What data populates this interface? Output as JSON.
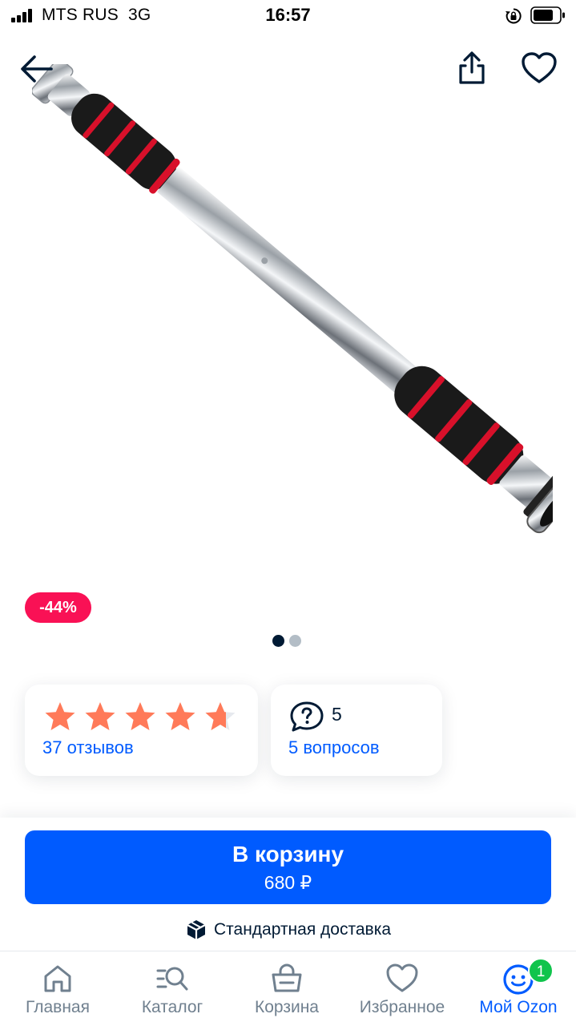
{
  "status_bar": {
    "carrier": "MTS RUS",
    "network": "3G",
    "time": "16:57"
  },
  "product": {
    "discount": "-44%",
    "image_slides": 2,
    "current_slide": 1
  },
  "rating": {
    "stars": 4.5,
    "reviews_label": "37 отзывов"
  },
  "questions": {
    "count": "5",
    "label": "5 вопросов"
  },
  "cart": {
    "button_label": "В корзину",
    "price": "680 ₽"
  },
  "delivery": {
    "label": "Стандартная доставка",
    "icon": "box-icon"
  },
  "colors": {
    "accent": "#005bff",
    "discount": "#f91155",
    "star": "#ff7a59",
    "badge": "#10c44c"
  },
  "tab_bar": {
    "items": [
      {
        "label": "Главная",
        "icon": "home-icon"
      },
      {
        "label": "Каталог",
        "icon": "catalog-search-icon"
      },
      {
        "label": "Корзина",
        "icon": "cart-basket-icon"
      },
      {
        "label": "Избранное",
        "icon": "heart-icon"
      },
      {
        "label": "Мой Ozon",
        "icon": "smiley-icon",
        "badge": "1"
      }
    ]
  }
}
